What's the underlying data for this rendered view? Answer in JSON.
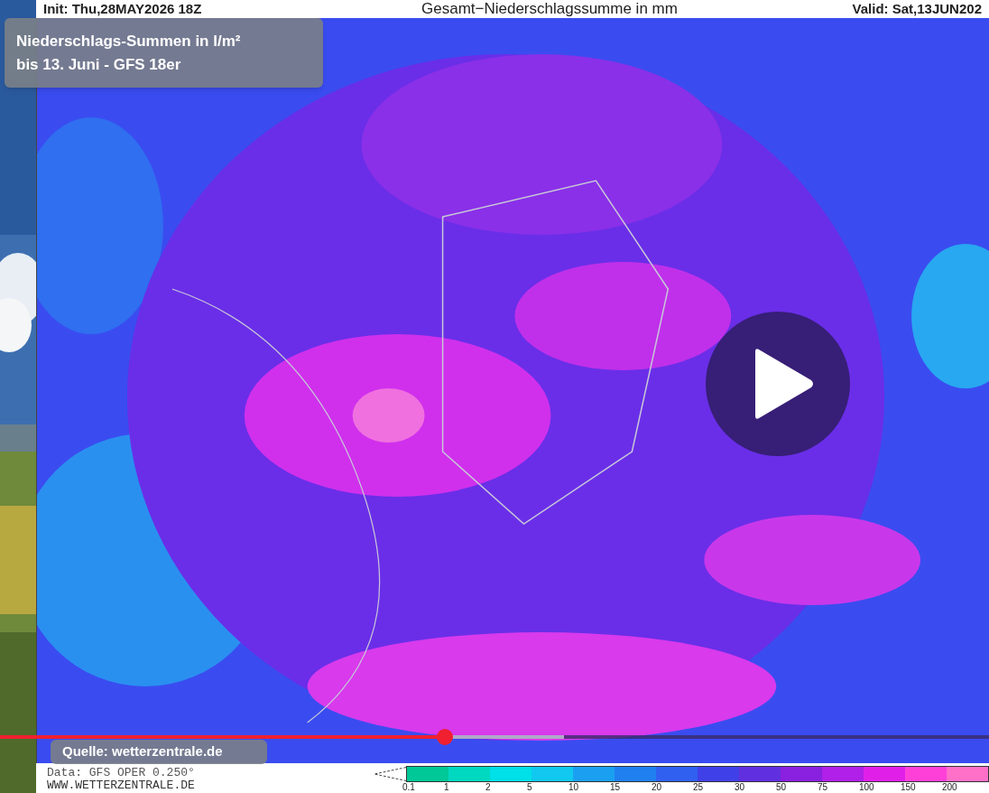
{
  "map_header": {
    "init": "Init: Thu,28MAY2026 18Z",
    "title": "Gesamt−Niederschlagssumme in mm",
    "valid": "Valid: Sat,13JUN202"
  },
  "caption": {
    "lines": [
      "Niederschlags-Summen in l/m²",
      "bis 13. Juni - GFS 18er"
    ]
  },
  "source": "Quelle: wetterzentrale.de",
  "player": {
    "playing": false,
    "progress": {
      "level": 0.45
    },
    "buffered": {
      "level": 0.57
    }
  },
  "legend": {
    "ticks": [
      "0.1",
      "1",
      "2",
      "5",
      "10",
      "15",
      "20",
      "25",
      "30",
      "50",
      "75",
      "100",
      "150",
      "200"
    ]
  },
  "footer": {
    "data": "Data: GFS OPER 0.250°",
    "website": "WWW.WETTERZENTRALE.DE"
  }
}
